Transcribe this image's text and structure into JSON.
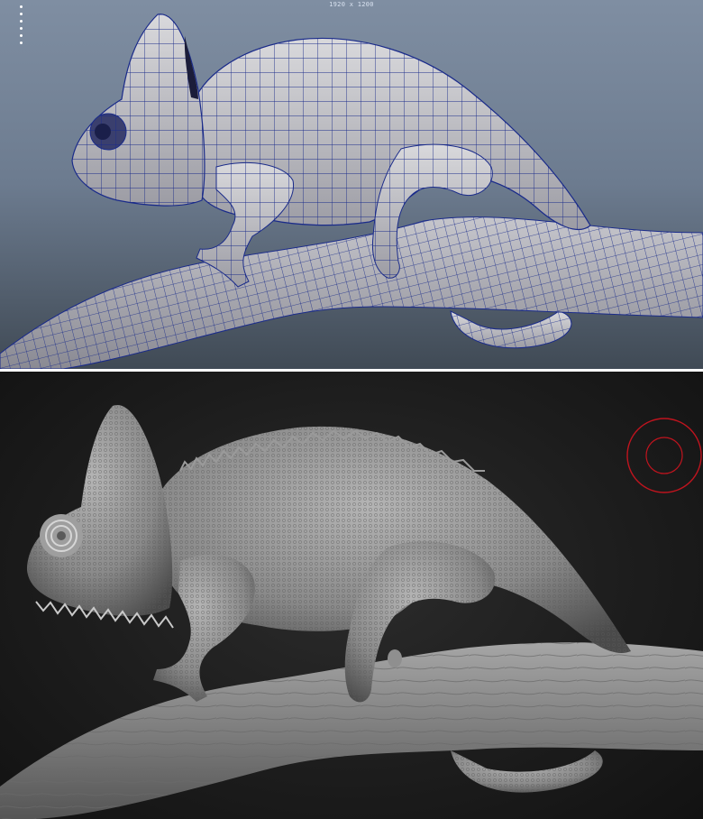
{
  "top_viewport": {
    "resolution_label": "1920 x 1200",
    "status_text": "",
    "wire_color": "#1a2b8a",
    "background_color": "#7f8ea2"
  },
  "bottom_viewport": {
    "background_color": "#1d1d1d",
    "brush_cursor_color": "#c0141e"
  },
  "icons": [
    "viewport-toolbar-dots-icon",
    "brush-cursor-icon"
  ]
}
